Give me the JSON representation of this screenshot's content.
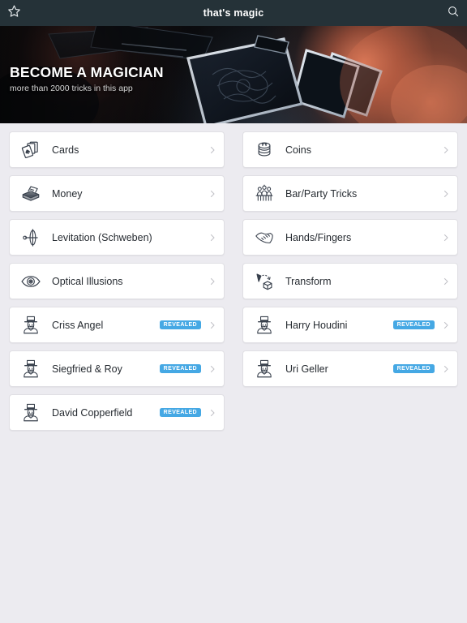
{
  "topbar": {
    "title": "that's magic",
    "favorite_icon": "star-icon",
    "search_icon": "search-icon"
  },
  "hero": {
    "title": "BECOME A MAGICIAN",
    "subtitle": "more than 2000 tricks in this app",
    "image_description": "hands fanning a deck of black playing cards"
  },
  "colors": {
    "topbar_bg": "#253238",
    "page_bg": "#ecebf0",
    "card_bg": "#ffffff",
    "badge_blue": "#45a8e4",
    "text_primary": "#262b31",
    "chevron": "#c2c2c8"
  },
  "badge_label": "REVEALED",
  "rows": [
    {
      "label": "Cards",
      "icon": "playing-cards-icon",
      "badge": null
    },
    {
      "label": "Coins",
      "icon": "coins-stack-icon",
      "badge": null
    },
    {
      "label": "Money",
      "icon": "money-bills-icon",
      "badge": null
    },
    {
      "label": "Bar/Party Tricks",
      "icon": "people-group-icon",
      "badge": null
    },
    {
      "label": "Levitation (Schweben)",
      "icon": "levitation-icon",
      "badge": null
    },
    {
      "label": "Hands/Fingers",
      "icon": "handshake-icon",
      "badge": null
    },
    {
      "label": "Optical Illusions",
      "icon": "eye-icon",
      "badge": null
    },
    {
      "label": "Transform",
      "icon": "transform-cube-icon",
      "badge": null
    },
    {
      "label": "Criss Angel",
      "icon": "magician-icon",
      "badge": "REVEALED"
    },
    {
      "label": "Harry Houdini",
      "icon": "magician-icon",
      "badge": "REVEALED"
    },
    {
      "label": "Siegfried & Roy",
      "icon": "magician-icon",
      "badge": "REVEALED"
    },
    {
      "label": "Uri Geller",
      "icon": "magician-icon",
      "badge": "REVEALED"
    },
    {
      "label": "David Copperfield",
      "icon": "magician-icon",
      "badge": "REVEALED"
    }
  ]
}
